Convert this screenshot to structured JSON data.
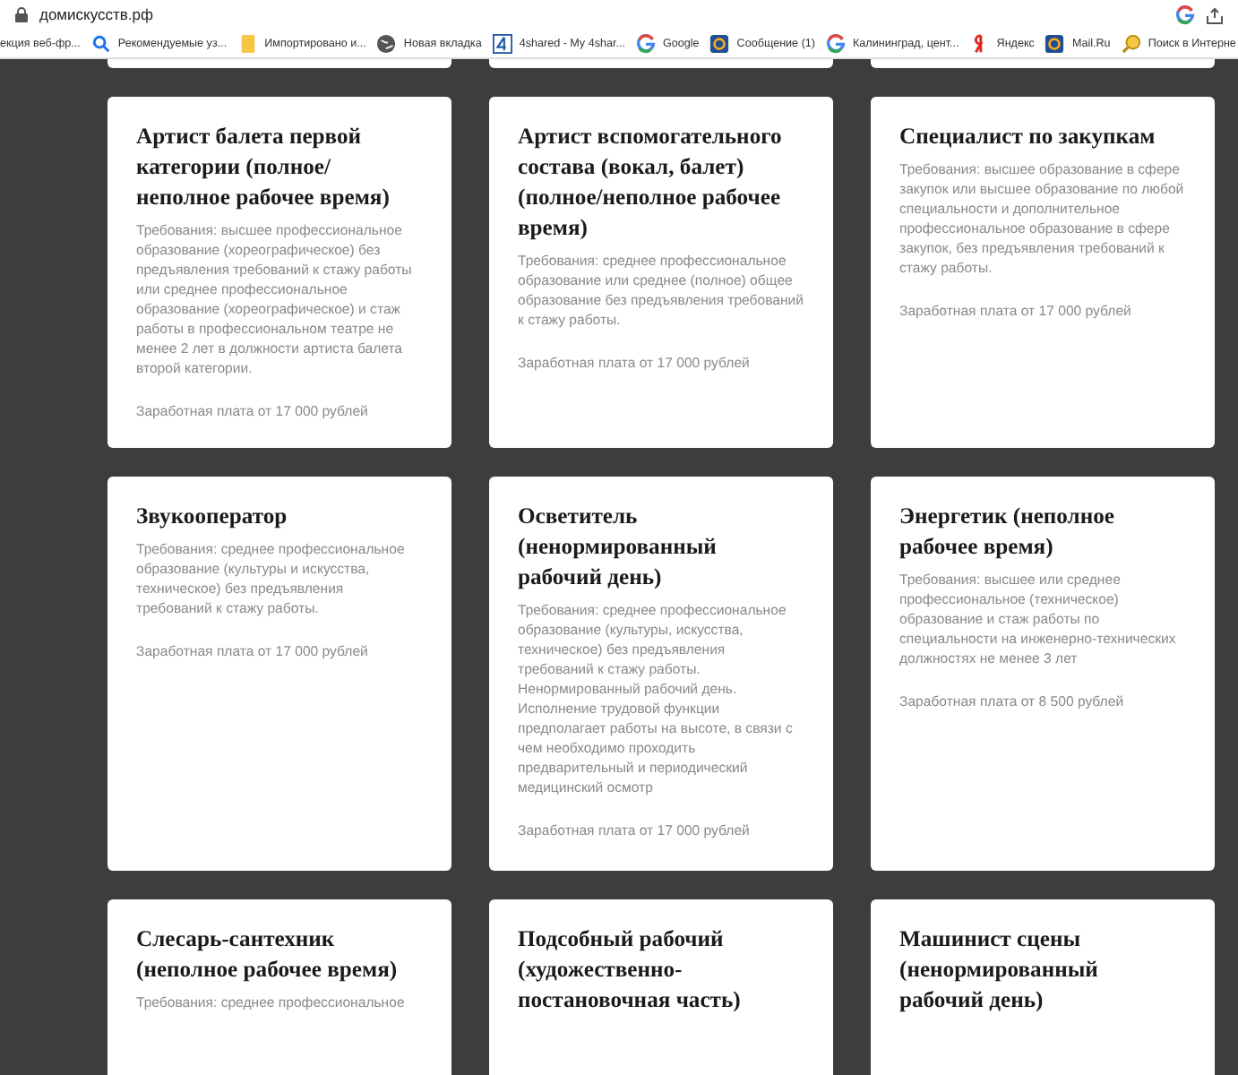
{
  "browser": {
    "address": "домискусств.рф",
    "bookmarks": [
      {
        "label": "екция веб-фр..."
      },
      {
        "label": "Рекомендуемые уз..."
      },
      {
        "label": "Импортировано и..."
      },
      {
        "label": "Новая вкладка"
      },
      {
        "label": "4shared - My 4shar..."
      },
      {
        "label": "Google"
      },
      {
        "label": "Сообщение (1)"
      },
      {
        "label": "Калининград, цент..."
      },
      {
        "label": "Яндекс"
      },
      {
        "label": "Mail.Ru"
      },
      {
        "label": "Поиск в Интерне"
      }
    ]
  },
  "jobs": [
    {
      "title": "Артист балета первой категории (полное/ неполное рабочее время)",
      "requirements": "Требования: высшее профессиональное образование (хореографическое) без предъявления требований к стажу работы или среднее профессиональное образование (хореографическое) и стаж работы в профессиональном театре не менее 2 лет в должности артиста балета второй категории.",
      "salary": "Заработная плата от 17 000 рублей"
    },
    {
      "title": "Артист вспомогательного состава (вокал, балет) (полное/неполное рабочее время)",
      "requirements": "Требования: среднее профессиональное образование или среднее (полное) общее образование без предъявления требований к стажу работы.",
      "salary": "Заработная плата от 17 000 рублей"
    },
    {
      "title": "Специалист по закупкам",
      "requirements": "Требования: высшее образование в сфере закупок или высшее образование по любой специальности и дополнительное профессиональное образование в сфере закупок, без предъявления требований к стажу работы.",
      "salary": "Заработная плата от 17 000 рублей"
    },
    {
      "title": "Звукооператор",
      "requirements": "Требования: среднее профессиональное образование (культуры и искусства, техническое) без предъявления требований к стажу работы.",
      "salary": "Заработная плата от 17 000 рублей"
    },
    {
      "title": "Осветитель (ненормированный рабочий день)",
      "requirements": "Требования: среднее профессиональное образование (культуры, искусства, техническое) без предъявления требований к стажу работы. Ненормированный рабочий день. Исполнение трудовой функции предполагает работы на высоте, в связи с чем необходимо проходить предварительный и периодический медицинский осмотр",
      "salary": "Заработная плата от 17 000 рублей"
    },
    {
      "title": "Энергетик (неполное рабочее время)",
      "requirements": "Требования: высшее или среднее профессиональное (техническое) образование и стаж работы по специальности на инженерно-технических должностях не менее 3 лет",
      "salary": "Заработная плата от 8 500 рублей"
    },
    {
      "title": "Слесарь-сантехник (неполное рабочее время)",
      "requirements": "Требования: среднее профессиональное"
    },
    {
      "title": "Подсобный рабочий (художественно-постановочная часть)"
    },
    {
      "title": "Машинист сцены (ненормированный рабочий день)"
    }
  ]
}
